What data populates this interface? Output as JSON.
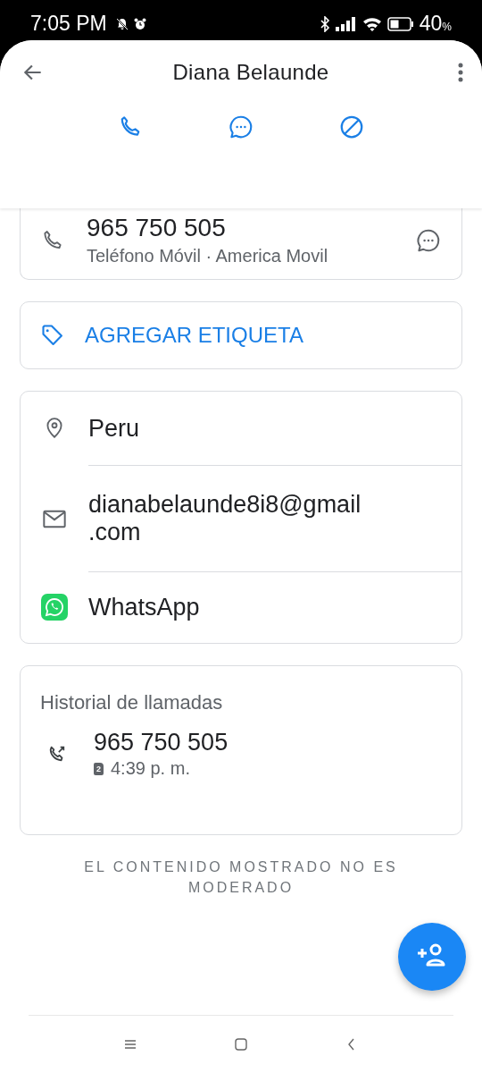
{
  "status_bar": {
    "time": "7:05 PM",
    "battery": "40",
    "battery_unit": "%"
  },
  "header": {
    "title": "Diana Belaunde"
  },
  "phone_card": {
    "number": "965 750 505",
    "type_carrier": "Teléfono Móvil · America Movil"
  },
  "tag_button": {
    "label": "AGREGAR ETIQUETA"
  },
  "info_rows": [
    {
      "kind": "location",
      "text": "Peru"
    },
    {
      "kind": "email",
      "text": "dianabelaunde8i8@gmail\n.com"
    },
    {
      "kind": "whatsapp",
      "text": "WhatsApp"
    }
  ],
  "call_history": {
    "title": "Historial de llamadas",
    "entries": [
      {
        "kind": "outgoing",
        "number": "965 750 505",
        "sim_slot": "2",
        "time": "4:39 p. m."
      }
    ]
  },
  "notice": "EL CONTENIDO MOSTRADO NO ES MODERADO"
}
